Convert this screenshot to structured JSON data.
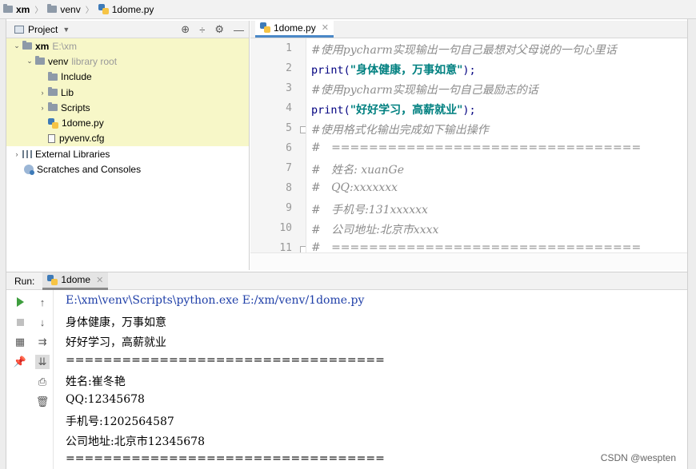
{
  "breadcrumb": [
    "xm",
    "venv",
    "1dome.py"
  ],
  "project": {
    "title": "Project",
    "tree": [
      {
        "label": "xm",
        "hint": "E:\\xm"
      },
      {
        "label": "venv",
        "hint": "library root"
      },
      {
        "label": "Include"
      },
      {
        "label": "Lib"
      },
      {
        "label": "Scripts"
      },
      {
        "label": "1dome.py"
      },
      {
        "label": "pyvenv.cfg"
      },
      {
        "label": "External Libraries"
      },
      {
        "label": "Scratches and Consoles"
      }
    ]
  },
  "editor": {
    "tab": "1dome.py",
    "line_numbers": [
      "1",
      "2",
      "3",
      "4",
      "5",
      "6",
      "7",
      "8",
      "9",
      "10",
      "11"
    ],
    "lines": {
      "l1": "#使用pycharm实现输出一句自己最想对父母说的一句心里话",
      "l2_fn": "print(",
      "l2_str": "\"身体健康，万事如意\"",
      "l2_end": ");",
      "l3": "#使用pycharm实现输出一句自己最励志的话",
      "l4_fn": "print(",
      "l4_str": "\"好好学习，高薪就业\"",
      "l4_end": ");",
      "l5": "#使用格式化输出完成如下输出操作",
      "l6": "#   =================================",
      "l7": "#   姓名: xuanGe",
      "l8": "#   QQ:xxxxxxx",
      "l9": "#   手机号:131xxxxxx",
      "l10": "#   公司地址:北京市xxxx",
      "l11": "#   ================================="
    }
  },
  "run": {
    "label": "Run:",
    "tab": "1dome",
    "output": [
      "E:\\xm\\venv\\Scripts\\python.exe E:/xm/venv/1dome.py",
      "身体健康，万事如意",
      "好好学习，高薪就业",
      "==================================",
      "姓名:崔冬艳",
      "QQ:12345678",
      "手机号:1202564587",
      "公司地址:北京市12345678",
      "=================================="
    ]
  },
  "watermark": "CSDN @wespten",
  "colors": {
    "comment": "#8c8c8c",
    "string": "#008080",
    "keyword": "#000080",
    "selection": "#f7f7c8",
    "tab_accent": "#4a88c7"
  }
}
